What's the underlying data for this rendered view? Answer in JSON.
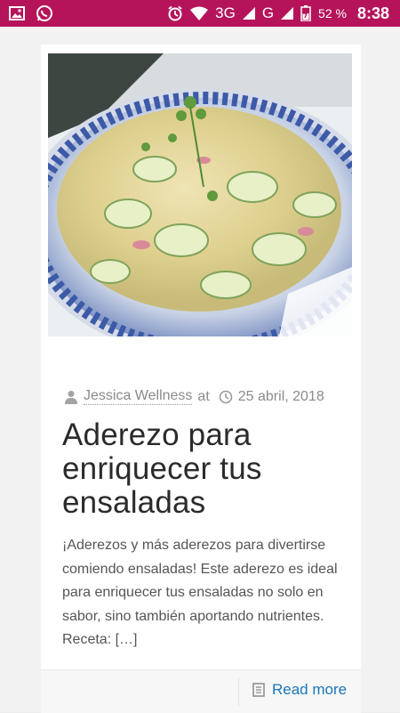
{
  "status_bar": {
    "network_3g": "3G",
    "network_g": "G",
    "battery": "52 %",
    "time": "8:38"
  },
  "post": {
    "author": "Jessica Wellness",
    "at": "at",
    "date": "25 abril, 2018",
    "title": "Aderezo para enriquecer tus ensaladas",
    "excerpt": "¡Aderezos y más aderezos para divertirse comiendo ensaladas! Este aderezo es ideal para enriquecer tus ensaladas no solo en sabor, sino también aportando nutrientes.     Receta: […]",
    "read_more": "Read more"
  },
  "colors": {
    "status_bar": "#b5145a",
    "link": "#1976b8"
  }
}
